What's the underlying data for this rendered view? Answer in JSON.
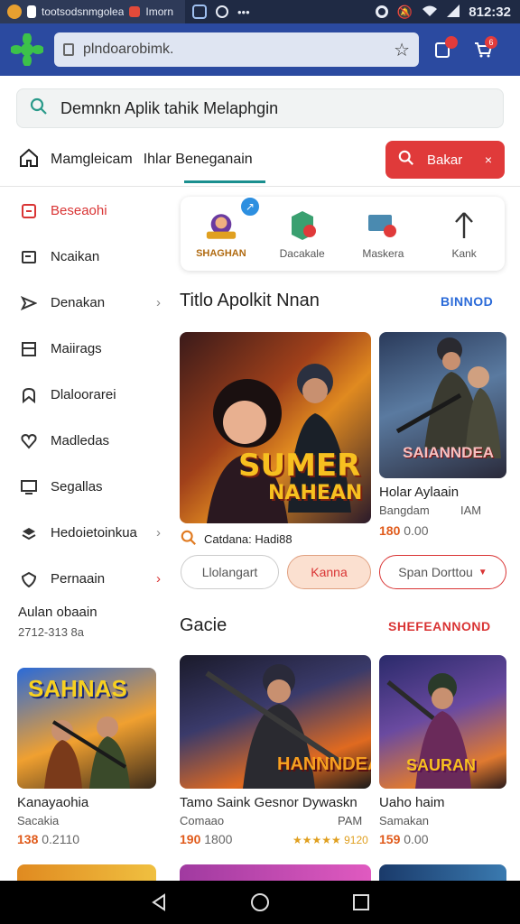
{
  "status_bar": {
    "tab_title": "tootsodsnmgolea",
    "second_tab": "Imorn",
    "overflow": "•••",
    "time": "812:32"
  },
  "browser": {
    "url": "plndoarobimk.",
    "cart_badge": "6"
  },
  "search": {
    "query": "Demnkn Aplik tahik Melaphgin"
  },
  "nav": {
    "home_label": "Mamgleicam",
    "separator": "I",
    "link_label": "hlar Beneganain",
    "red_button_label": "Bakar",
    "red_button_close": "×"
  },
  "sidebar": {
    "items": [
      {
        "label": "Beseaohi",
        "icon": "bookmark-icon",
        "chevron": ""
      },
      {
        "label": "Ncaikan",
        "icon": "card-icon",
        "chevron": ""
      },
      {
        "label": "Denakan",
        "icon": "send-icon",
        "chevron": "›"
      },
      {
        "label": "Maiirags",
        "icon": "window-icon",
        "chevron": ""
      },
      {
        "label": "Dlaloorarei",
        "icon": "puzzle-icon",
        "chevron": ""
      },
      {
        "label": "Madledas",
        "icon": "heart-icon",
        "chevron": ""
      },
      {
        "label": "Segallas",
        "icon": "monitor-icon",
        "chevron": ""
      },
      {
        "label": "Hedoietoinkua",
        "icon": "stack-icon",
        "chevron": "›"
      },
      {
        "label": "Pernaain",
        "icon": "shield-icon",
        "chevron": "›"
      }
    ],
    "stats_title": "Aulan obaain",
    "stats_value": "2712-313 8a"
  },
  "categories": [
    {
      "label": "SHAGHAN",
      "icon": "game-character-icon"
    },
    {
      "label": "Dacakale",
      "icon": "gift-icon"
    },
    {
      "label": "Maskera",
      "icon": "media-icon"
    },
    {
      "label": "Kank",
      "icon": "arrow-up-icon"
    }
  ],
  "category_badge": "↗",
  "section1": {
    "title": "Titlo Apolkit Nnan",
    "link": "BINNOD"
  },
  "featured": {
    "image_title_line1": "SUMER",
    "image_title_line2": "NAHEAN",
    "caption": "Catdana: Hadi88"
  },
  "side_game": {
    "image_title": "SAIANNDEA",
    "title": "Holar Aylaain",
    "sub_left": "Bangdam",
    "sub_right": "IAM",
    "price": "180",
    "price_old": "0.00"
  },
  "chips": {
    "chip1": "Llolangart",
    "chip2": "Kanna",
    "chip3": "Span Dorttou"
  },
  "section2": {
    "title": "Gacie",
    "link": "SHEFEANNOND"
  },
  "games": [
    {
      "image_title": "SAHNAS",
      "title": "Kanayaohia",
      "sub": "Sacakia",
      "sub_right": "",
      "price": "138",
      "price_old": "0.2110",
      "rating": ""
    },
    {
      "image_title": "HANNNDEA",
      "title": "Tamo Saink Gesnor Dywaskn",
      "sub": "Comaao",
      "sub_right": "PAM",
      "price": "190",
      "price_old": "1800",
      "rating": "★★★★★ 9120"
    },
    {
      "image_title": "SAURAN",
      "title": "Uaho haim",
      "sub": "Samakan",
      "sub_right": "",
      "price": "159",
      "price_old": "0.00",
      "rating": ""
    }
  ],
  "colors": {
    "accent_red": "#e03a3a",
    "browser_blue": "#2b4aa0",
    "price_orange": "#e05a1a",
    "teal": "#1a8f8f"
  }
}
